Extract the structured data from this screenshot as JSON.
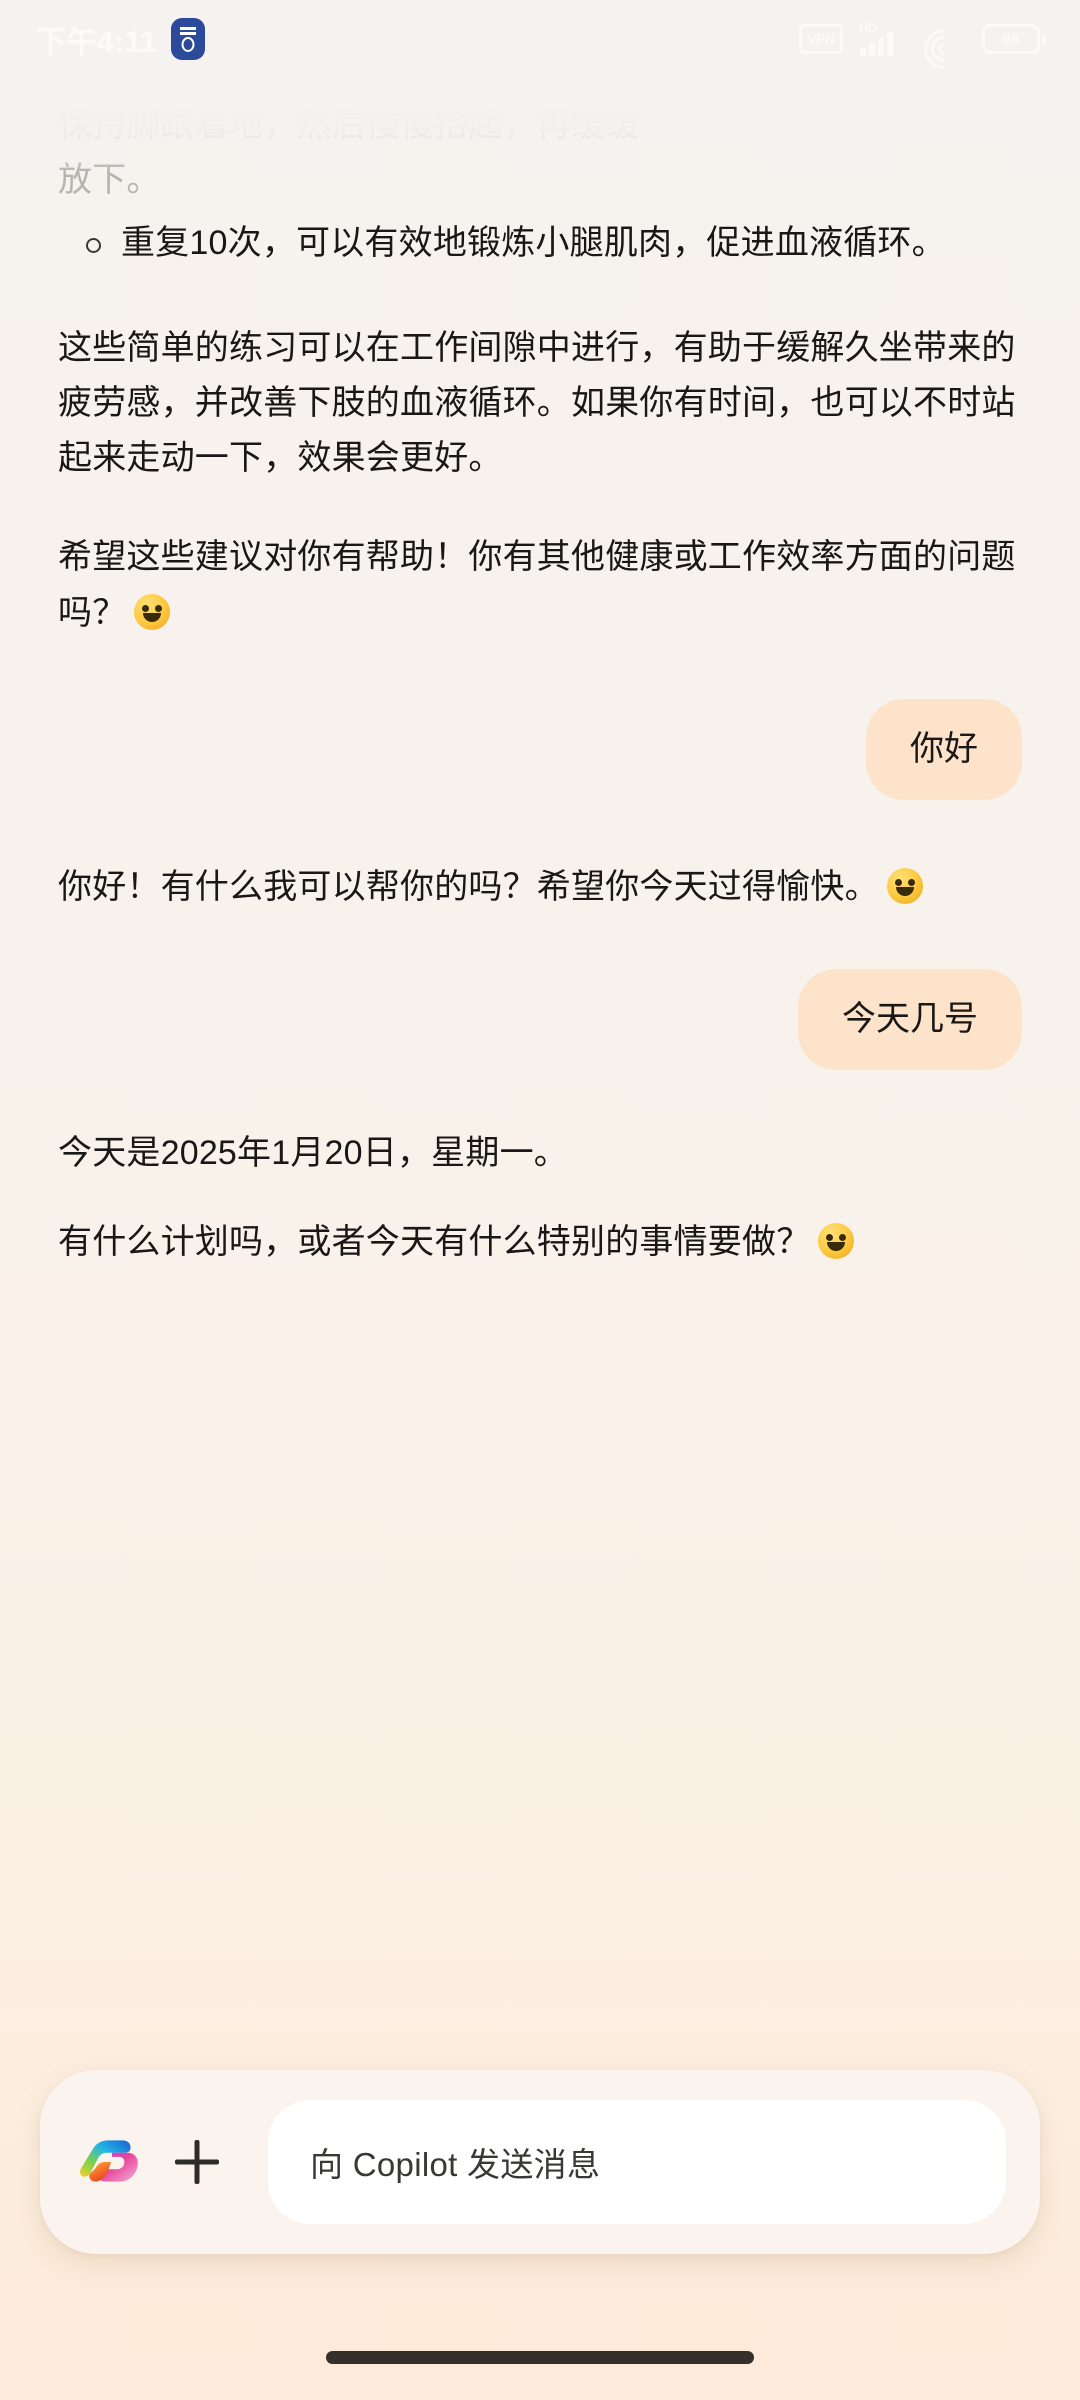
{
  "app": {
    "name": "Microsoft Copilot"
  },
  "status_bar": {
    "time": "下午4:11",
    "badge_icon": "do-not-disturb-badge",
    "vpn_label": "VPN",
    "network_label": "HD",
    "signal_icon": "cellular-signal-icon",
    "wifi_icon": "wifi-icon",
    "battery_percent": "98"
  },
  "conversation": {
    "messages": [
      {
        "role": "assistant",
        "kind": "bullet",
        "faded_line": "保持脚跟着地，然后慢慢抬起，再缓缓",
        "faded_line2": "放下。",
        "bullet_text": "重复10次，可以有效地锻炼小腿肌肉，促进血液循环。"
      },
      {
        "role": "assistant",
        "kind": "paragraph",
        "text": "这些简单的练习可以在工作间隙中进行，有助于缓解久坐带来的疲劳感，并改善下肢的血液循环。如果你有时间，也可以不时站起来走动一下，效果会更好。"
      },
      {
        "role": "assistant",
        "kind": "paragraph",
        "text": "希望这些建议对你有帮助！你有其他健康或工作效率方面的问题吗？",
        "emoji": "smiling-face-with-smiling-eyes"
      },
      {
        "role": "user",
        "kind": "bubble",
        "text": "你好"
      },
      {
        "role": "assistant",
        "kind": "paragraph",
        "text": "你好！有什么我可以帮你的吗？希望你今天过得愉快。",
        "emoji": "smiling-face-with-smiling-eyes"
      },
      {
        "role": "user",
        "kind": "bubble",
        "text": "今天几号"
      },
      {
        "role": "assistant",
        "kind": "paragraph",
        "text": "今天是2025年1月20日，星期一。"
      },
      {
        "role": "assistant",
        "kind": "paragraph",
        "text": "有什么计划吗，或者今天有什么特别的事情要做？",
        "emoji": "smiling-face-with-smiling-eyes"
      }
    ]
  },
  "composer": {
    "logo_icon": "copilot-logo-icon",
    "add_icon": "plus-icon",
    "placeholder": "向 Copilot 发送消息",
    "input_value": ""
  },
  "colors": {
    "background_top": "#f6f2ef",
    "background_bottom": "#fdeada",
    "user_bubble": "#fce3c9",
    "text_primary": "#191817",
    "composer_bg": "#fbf4ee",
    "input_bg": "#ffffff",
    "gesture_bar": "#332f2b"
  },
  "navigation": {
    "gesture_bar": "home-gesture-bar"
  }
}
